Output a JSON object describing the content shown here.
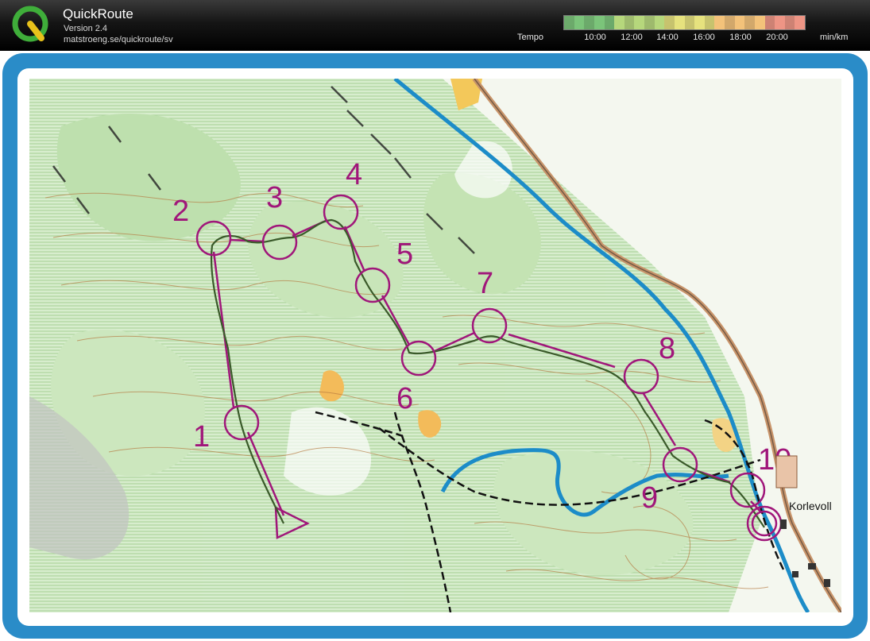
{
  "app": {
    "title": "QuickRoute",
    "version": "Version 2.4",
    "url": "matstroeng.se/quickroute/sv"
  },
  "tempo": {
    "label": "Tempo",
    "ticks": [
      "10:00",
      "12:00",
      "14:00",
      "16:00",
      "18:00",
      "20:00"
    ],
    "unit": "min/km",
    "scale_colors": [
      "#7bc47a",
      "#b6d77c",
      "#e6e27e",
      "#f3c27a",
      "#ee9585"
    ]
  },
  "map": {
    "place_label": "Korlevoll",
    "controls": [
      {
        "label": "1"
      },
      {
        "label": "2"
      },
      {
        "label": "3"
      },
      {
        "label": "4"
      },
      {
        "label": "5"
      },
      {
        "label": "6"
      },
      {
        "label": "7"
      },
      {
        "label": "8"
      },
      {
        "label": "9"
      },
      {
        "label": "10"
      }
    ],
    "course_color": "#a0167a",
    "route_color": "#3a5a2a"
  }
}
